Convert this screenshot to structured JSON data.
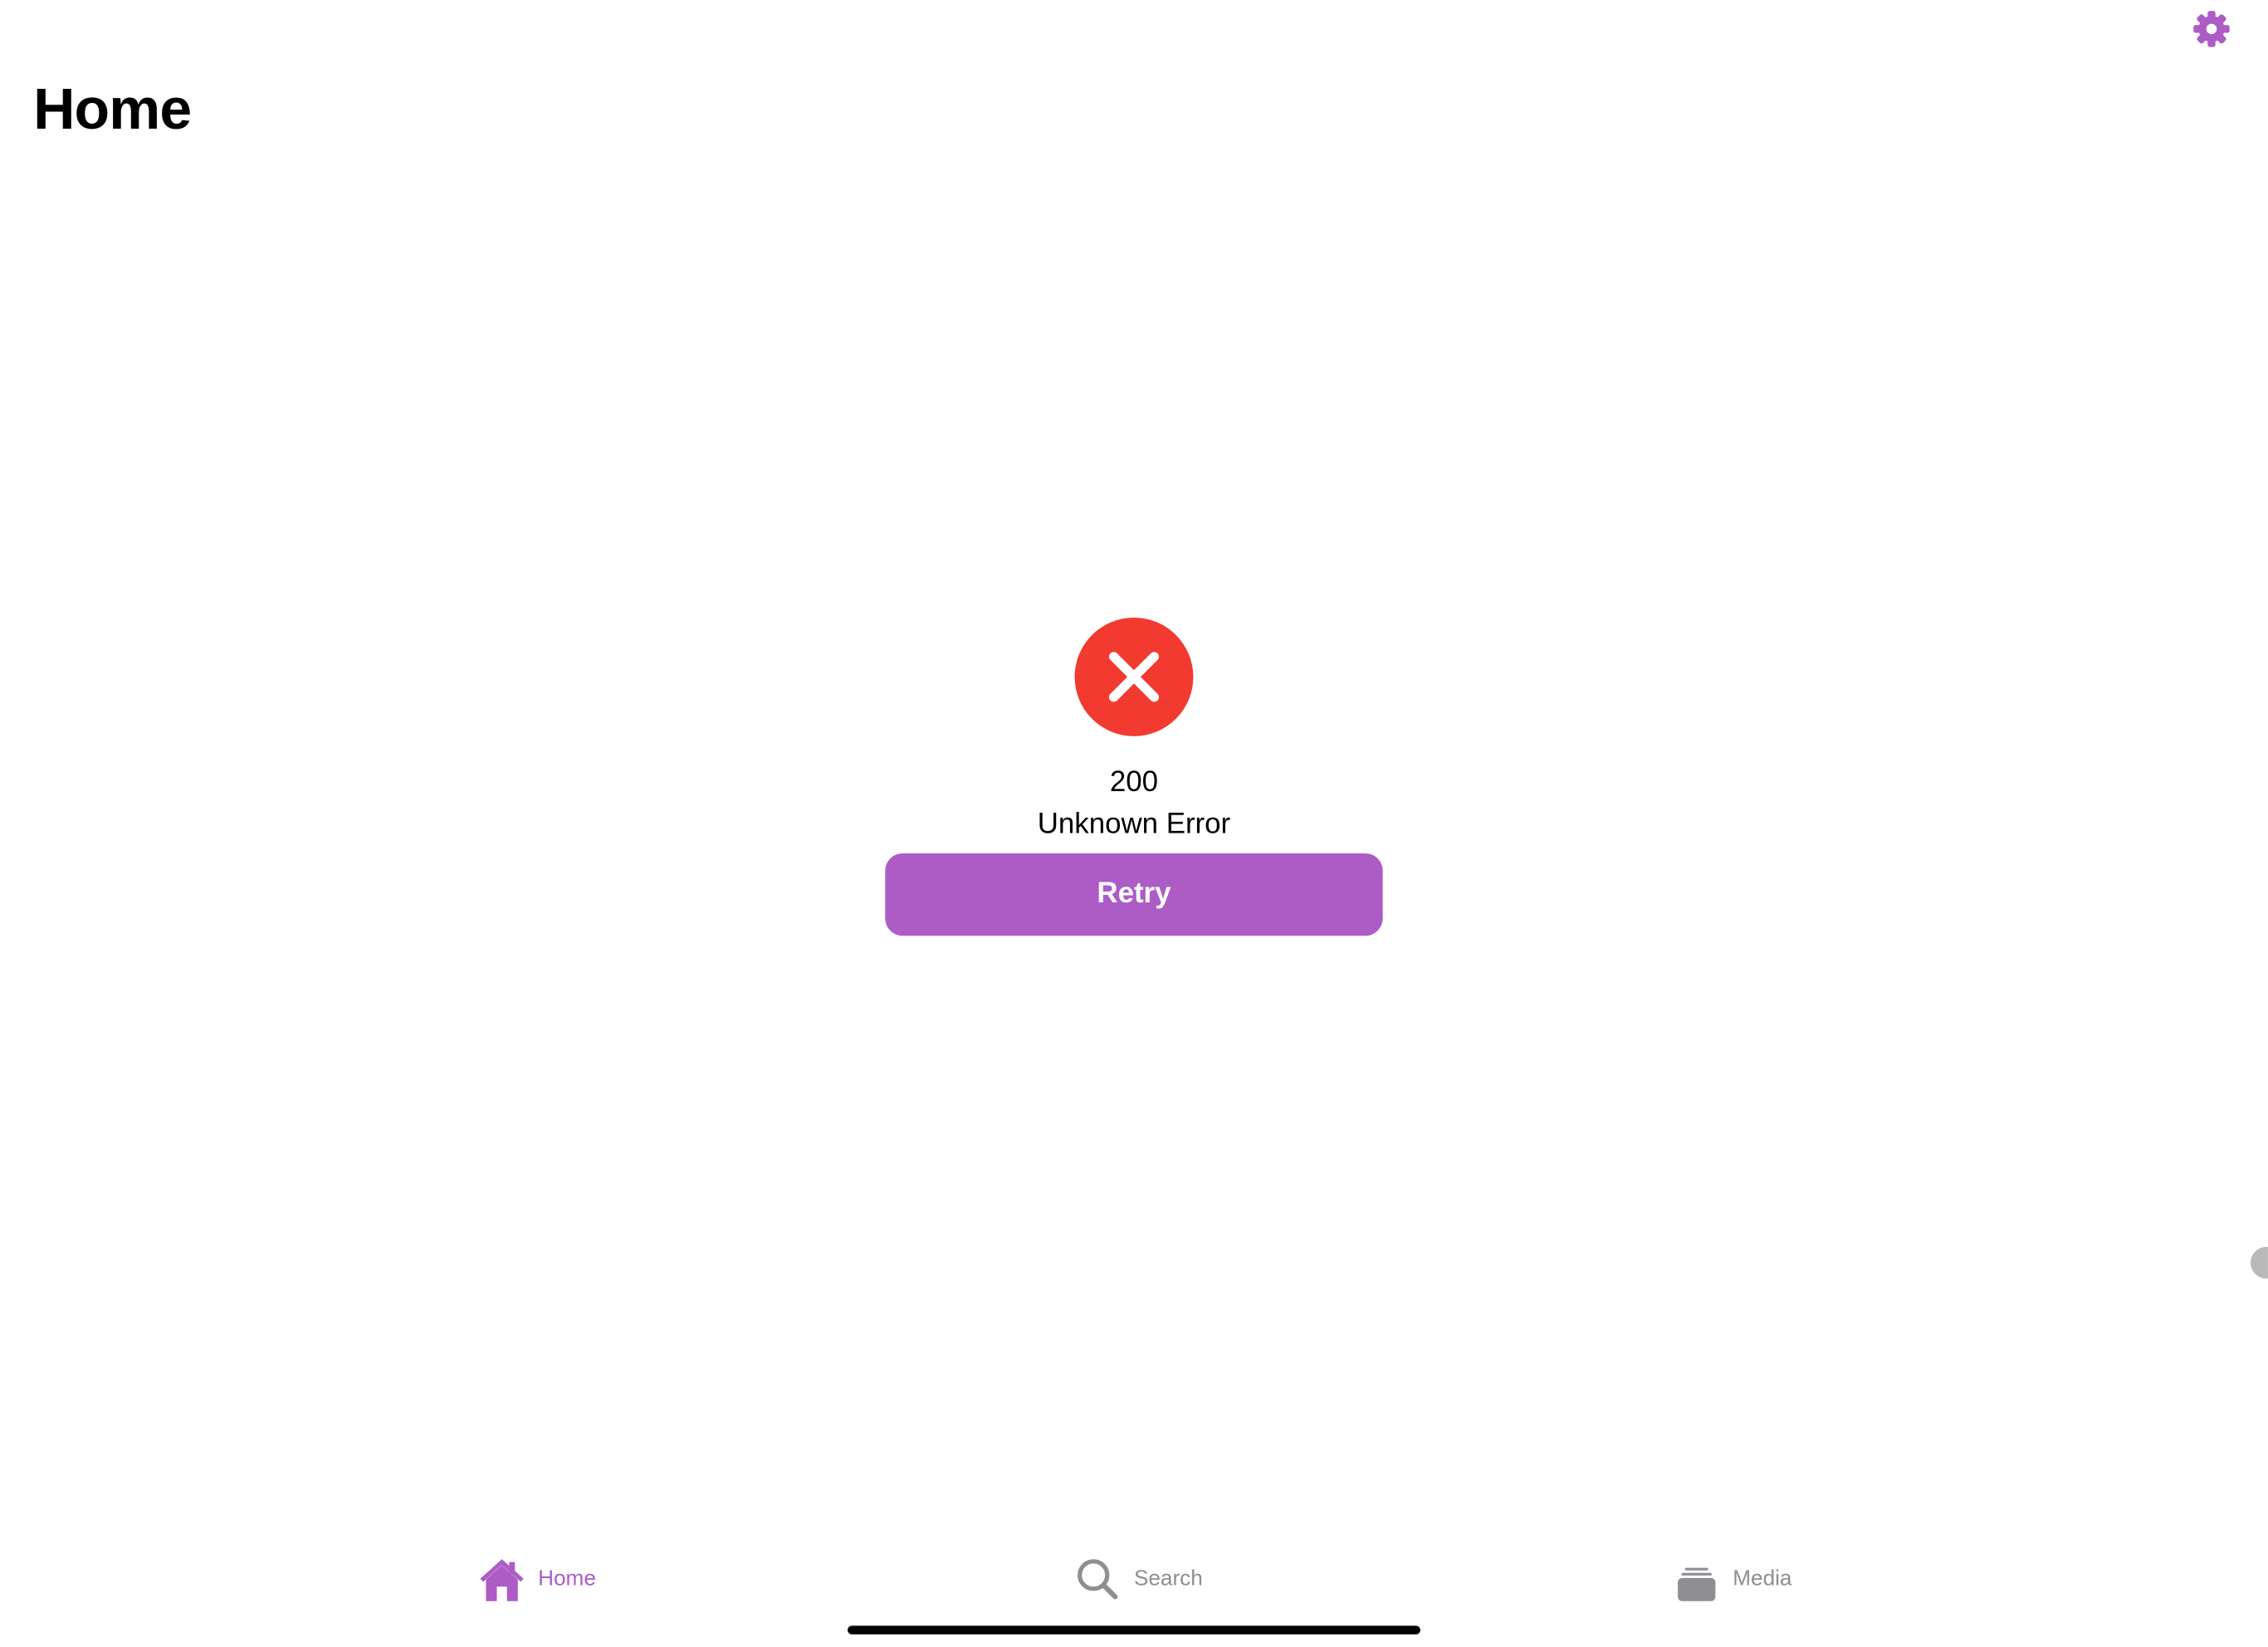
{
  "header": {
    "title": "Home",
    "settings_icon": "gear-icon"
  },
  "error": {
    "icon": "xmark-circle-icon",
    "code": "200",
    "message": "Unknown Error",
    "retry_label": "Retry"
  },
  "tabbar": {
    "items": [
      {
        "label": "Home",
        "icon": "house-icon",
        "selected": true
      },
      {
        "label": "Search",
        "icon": "magnifying-glass-icon",
        "selected": false
      },
      {
        "label": "Media",
        "icon": "media-stack-icon",
        "selected": false
      }
    ]
  },
  "colors": {
    "accent": "#AD5CC6",
    "error": "#F33A30",
    "inactive": "#8E8E93",
    "text": "#000000",
    "background": "#FFFFFF"
  }
}
